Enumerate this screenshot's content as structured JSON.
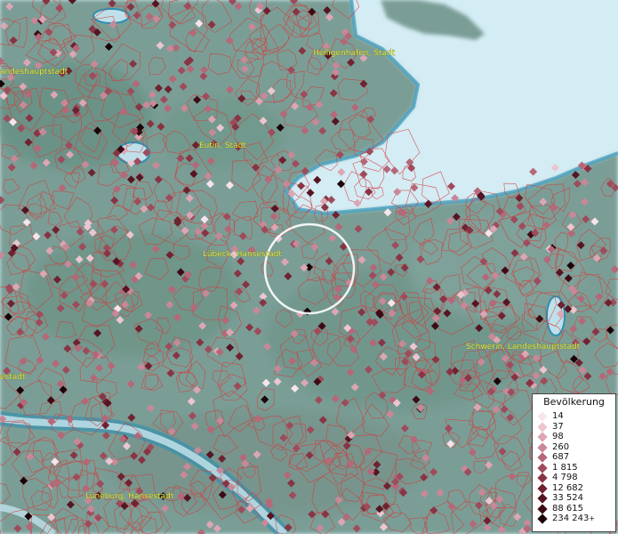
{
  "map": {
    "labels": [
      {
        "id": "heiligenhafen",
        "text": "Heiligenhafen, Stadt"
      },
      {
        "id": "kiel",
        "text": "andeshauptstadt"
      },
      {
        "id": "eutin",
        "text": "Eutin, Stadt"
      },
      {
        "id": "luebeck",
        "text": "Lübeck, Hansestadt"
      },
      {
        "id": "schwerin",
        "text": "Schwerin, Landeshauptstadt"
      },
      {
        "id": "hamburg",
        "text": "estadt"
      },
      {
        "id": "lueneburg",
        "text": "Lüneburg, Hansestadt"
      }
    ],
    "colors": {
      "sea": "#d4ecf4",
      "land": "#7a9e96",
      "boundary": "#d63a3a",
      "label": "#e8e83a",
      "focus_circle": "#ffffff"
    }
  },
  "legend": {
    "title": "Bevölkerung",
    "items": [
      {
        "label": "14",
        "color": "#f7e4ec"
      },
      {
        "label": "37",
        "color": "#ebc6d0"
      },
      {
        "label": "98",
        "color": "#dca6b4"
      },
      {
        "label": "260",
        "color": "#c98898"
      },
      {
        "label": "687",
        "color": "#b46878"
      },
      {
        "label": "1 815",
        "color": "#9e4c5c"
      },
      {
        "label": "4 798",
        "color": "#883444"
      },
      {
        "label": "12 682",
        "color": "#702230"
      },
      {
        "label": "33 524",
        "color": "#561522"
      },
      {
        "label": "88 615",
        "color": "#3c0b15"
      },
      {
        "label": "234 243",
        "color": "#1a0308",
        "plus": "+"
      }
    ]
  }
}
